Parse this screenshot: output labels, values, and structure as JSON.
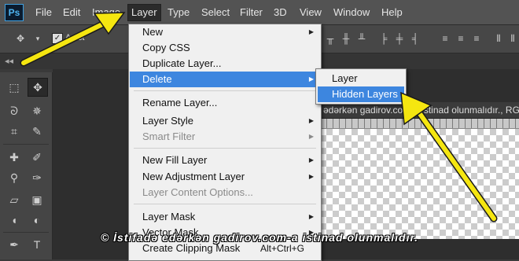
{
  "app": {
    "logo": "Ps"
  },
  "menubar": {
    "items": [
      "File",
      "Edit",
      "Image",
      "Layer",
      "Type",
      "Select",
      "Filter",
      "3D",
      "View",
      "Window",
      "Help"
    ],
    "active": "Layer"
  },
  "options_bar": {
    "checkbox_checked": true,
    "auto_select_fragment": "A    ect"
  },
  "document": {
    "tab_title": "ədərkən gadirov.com-a istinad olunmalıdır., RGB"
  },
  "layer_menu": {
    "items": [
      {
        "label": "New",
        "submenu": true,
        "disabled": false
      },
      {
        "label": "Copy CSS",
        "submenu": false,
        "disabled": false
      },
      {
        "label": "Duplicate Layer...",
        "submenu": false,
        "disabled": false
      },
      {
        "label": "Delete",
        "submenu": true,
        "disabled": false,
        "highlighted": true
      },
      {
        "label": "Rename Layer...",
        "submenu": false,
        "disabled": false
      },
      {
        "label": "Layer Style",
        "submenu": true,
        "disabled": false
      },
      {
        "label": "Smart Filter",
        "submenu": true,
        "disabled": true
      },
      {
        "label": "New Fill Layer",
        "submenu": true,
        "disabled": false
      },
      {
        "label": "New Adjustment Layer",
        "submenu": true,
        "disabled": false
      },
      {
        "label": "Layer Content Options...",
        "submenu": false,
        "disabled": true
      },
      {
        "label": "Layer Mask",
        "submenu": true,
        "disabled": false
      },
      {
        "label": "Vector Mask",
        "submenu": true,
        "disabled": false
      },
      {
        "label": "Create Clipping Mask",
        "shortcut": "Alt+Ctrl+G",
        "submenu": false,
        "disabled": false
      }
    ]
  },
  "delete_submenu": {
    "items": [
      {
        "label": "Layer",
        "highlighted": false
      },
      {
        "label": "Hidden Layers",
        "highlighted": true
      }
    ]
  },
  "annotations": {
    "arrow_color": "#f5e610"
  },
  "watermark": {
    "text": "© İstifadə edərkən gadirov.com-a istinad olunmalıdır."
  },
  "colors": {
    "menu_highlight": "#3d86df",
    "menubar_bg": "#535353"
  }
}
